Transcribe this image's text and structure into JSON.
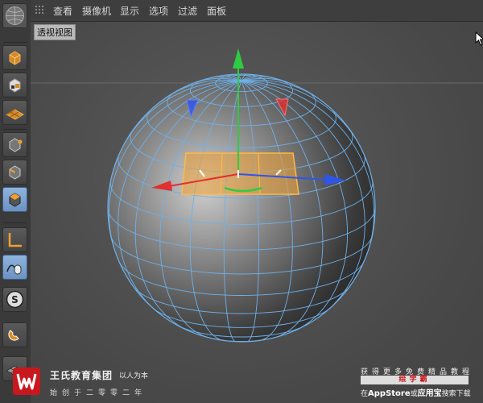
{
  "menubar": {
    "items": [
      "查看",
      "摄像机",
      "显示",
      "选项",
      "过滤",
      "面板"
    ]
  },
  "viewport": {
    "label": "透视视图"
  },
  "toolbar": {
    "tools": [
      {
        "name": "logo-sphere-icon"
      },
      {
        "name": "model-mode-icon"
      },
      {
        "name": "texture-mode-icon"
      },
      {
        "name": "workplane-icon"
      },
      {
        "name": "points-mode-icon"
      },
      {
        "name": "edges-mode-icon"
      },
      {
        "name": "polygons-mode-icon",
        "active": true
      },
      {
        "name": "axis-icon"
      },
      {
        "name": "tweak-mode-icon",
        "active": true
      },
      {
        "name": "snap-icon"
      },
      {
        "name": "magnet-icon"
      },
      {
        "name": "grid-floor-icon"
      }
    ]
  },
  "colors": {
    "selection": "#f0a030",
    "wire": "#6fb0e8",
    "axis_x": "#e03030",
    "axis_y": "#2ecc40",
    "axis_z": "#2f55e8"
  },
  "branding": {
    "name": "王氏教育集团",
    "tagline": "以人为本",
    "sub": "始创于二零零二年",
    "promo_line1": "获得更多免费精品教程",
    "promo_badge": "绘学霸",
    "promo_line2_prefix": "在",
    "promo_line2_store": "AppStore",
    "promo_line2_mid": "或",
    "promo_line2_app": "应用宝",
    "promo_line2_suffix": "搜索下载"
  }
}
